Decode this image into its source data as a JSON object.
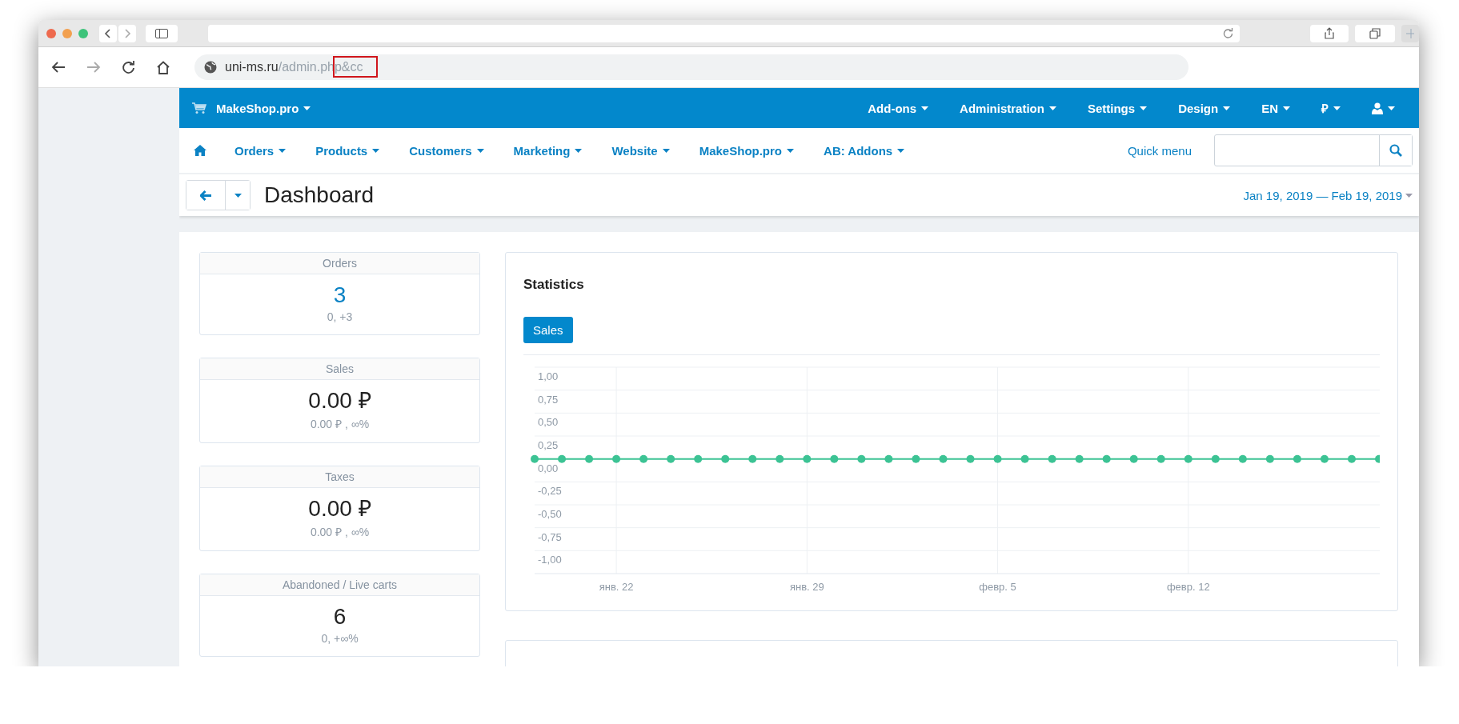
{
  "browser": {
    "address": {
      "host": "uni-ms.ru",
      "path": "/admin.ph",
      "marked": "p&cc"
    }
  },
  "topbar": {
    "brand": "MakeShop.pro",
    "menu": [
      {
        "label": "Add-ons"
      },
      {
        "label": "Administration"
      },
      {
        "label": "Settings"
      },
      {
        "label": "Design"
      },
      {
        "label": "EN"
      },
      {
        "label": "₽"
      }
    ]
  },
  "nav": {
    "items": [
      {
        "label": "Orders"
      },
      {
        "label": "Products"
      },
      {
        "label": "Customers"
      },
      {
        "label": "Marketing"
      },
      {
        "label": "Website"
      },
      {
        "label": "MakeShop.pro"
      },
      {
        "label": "AB: Addons"
      }
    ],
    "quick_menu": "Quick menu"
  },
  "header": {
    "title": "Dashboard",
    "date_range": "Jan 19, 2019 — Feb 19, 2019"
  },
  "stats": [
    {
      "title": "Orders",
      "value": "3",
      "change": "0, +3",
      "kind": "link"
    },
    {
      "title": "Sales",
      "value": "0.00 ₽",
      "change": "0.00 ₽ , ∞%",
      "kind": "plain"
    },
    {
      "title": "Taxes",
      "value": "0.00 ₽",
      "change": "0.00 ₽ , ∞%",
      "kind": "plain"
    },
    {
      "title": "Abandoned / Live carts",
      "value": "6",
      "change": "0, +∞%",
      "kind": "plain"
    }
  ],
  "statistics": {
    "title": "Statistics",
    "tabs": [
      {
        "label": "Sales",
        "selected": true
      }
    ],
    "chart_data": {
      "type": "line",
      "categories": [
        null,
        null,
        null,
        "янв. 22",
        null,
        null,
        null,
        null,
        null,
        null,
        "янв. 29",
        null,
        null,
        null,
        null,
        null,
        null,
        "февр. 5",
        null,
        null,
        null,
        null,
        null,
        null,
        "февр. 12",
        null,
        null,
        null,
        null,
        null,
        null,
        null
      ],
      "grid": true,
      "series": [
        {
          "color": "#3cc394",
          "marker": true,
          "values": [
            0,
            0,
            0,
            0,
            0,
            0,
            0,
            0,
            0,
            0,
            0,
            0,
            0,
            0,
            0,
            0,
            0,
            0,
            0,
            0,
            0,
            0,
            0,
            0,
            0,
            0,
            0,
            0,
            0,
            0,
            0,
            0
          ]
        }
      ],
      "ylim": [
        -1.25,
        1
      ],
      "yticks": [
        {
          "value": 1,
          "label": "1,00"
        },
        {
          "value": 0.75,
          "label": "0,75"
        },
        {
          "value": 0.5,
          "label": "0,50"
        },
        {
          "value": 0.25,
          "label": "0,25"
        },
        {
          "value": 0,
          "label": "0,00"
        },
        {
          "value": -0.25,
          "label": "-0,25"
        },
        {
          "value": -0.5,
          "label": "-0,50"
        },
        {
          "value": -0.75,
          "label": "-0,75"
        },
        {
          "value": -1,
          "label": "-1,00"
        }
      ]
    }
  }
}
